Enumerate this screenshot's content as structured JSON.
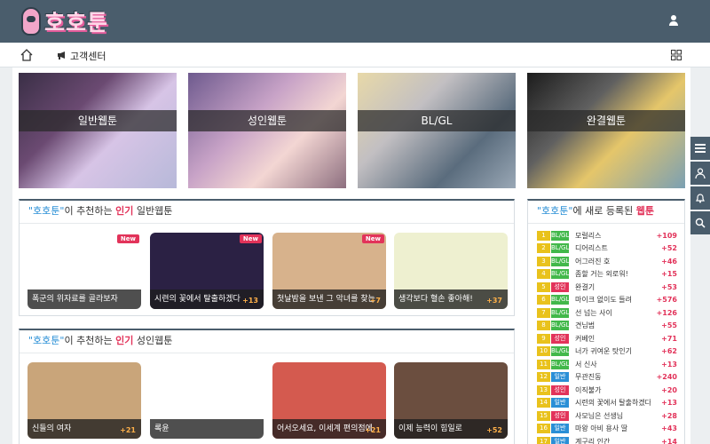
{
  "header": {
    "logo_text": "호호툰",
    "user_icon": "user-icon"
  },
  "subnav": {
    "home_icon": "home-icon",
    "cs_label": "고객센터",
    "cs_icon": "megaphone-icon",
    "grid_icon": "grid-icon"
  },
  "banners": [
    {
      "label": "일반웹툰"
    },
    {
      "label": "성인웹툰"
    },
    {
      "label": "BL/GL"
    },
    {
      "label": "완결웹툰"
    }
  ],
  "general_section": {
    "brand": "\"호호툰\"",
    "mid": "이 추천하는",
    "hot": "인기",
    "tail": "일반웹툰",
    "cards": [
      {
        "title": "폭군의 위자료를 골라보자",
        "count": "",
        "new": "New",
        "bg": "#ffffff"
      },
      {
        "title": "시련의 꽃에서 탈출하겠다",
        "count": "+13",
        "new": "New",
        "bg": "#2b2144"
      },
      {
        "title": "첫날밤을 보낸 그 악녀를 찾는",
        "count": "+7",
        "new": "New",
        "bg": "#d7b28c"
      },
      {
        "title": "생각보다 혈손 좋아해!",
        "count": "+37",
        "new": "",
        "bg": "#eef0d0"
      }
    ]
  },
  "adult_section": {
    "brand": "\"호호툰\"",
    "mid": "이 추천하는",
    "hot": "인기",
    "tail": "성인웹툰",
    "cards": [
      {
        "title": "신들의 여자",
        "count": "+21",
        "bg": "#c9a57a"
      },
      {
        "title": "록윤",
        "count": "",
        "bg": "#ffffff"
      },
      {
        "title": "어서오세요, 이세계 편의점에",
        "count": "+21",
        "bg": "#d45a4f"
      },
      {
        "title": "이제 능력이 힘일로",
        "count": "+52",
        "bg": "#6b4e3f"
      }
    ]
  },
  "ranking": {
    "brand": "\"호호툰\"",
    "mid": "에 새로 등록된",
    "hot": "웹툰",
    "items": [
      {
        "num": "1",
        "cat": "BL/GL",
        "title": "모럴리스",
        "delta": "+109"
      },
      {
        "num": "2",
        "cat": "BL/GL",
        "title": "디어리스트",
        "delta": "+52"
      },
      {
        "num": "3",
        "cat": "BL/GL",
        "title": "어그러진 호",
        "delta": "+46"
      },
      {
        "num": "4",
        "cat": "BL/GL",
        "title": "좀할 거는 외로워!",
        "delta": "+15"
      },
      {
        "num": "5",
        "cat": "성인",
        "title": "완결기",
        "delta": "+53"
      },
      {
        "num": "6",
        "cat": "BL/GL",
        "title": "마이크 없이도 들려",
        "delta": "+576"
      },
      {
        "num": "7",
        "cat": "BL/GL",
        "title": "선 넘는 사이",
        "delta": "+126"
      },
      {
        "num": "8",
        "cat": "BL/GL",
        "title": "견님범",
        "delta": "+55"
      },
      {
        "num": "9",
        "cat": "성인",
        "title": "커베인",
        "delta": "+71"
      },
      {
        "num": "10",
        "cat": "BL/GL",
        "title": "너가 귀여운 탓인기",
        "delta": "+62"
      },
      {
        "num": "11",
        "cat": "BL/GL",
        "title": "서 신사",
        "delta": "+13"
      },
      {
        "num": "12",
        "cat": "일반",
        "title": "무관진동",
        "delta": "+240"
      },
      {
        "num": "13",
        "cat": "성인",
        "title": "이직불가",
        "delta": "+20"
      },
      {
        "num": "14",
        "cat": "일반",
        "title": "시련의 꽃에서 탈출하겠다",
        "delta": "+13"
      },
      {
        "num": "15",
        "cat": "성인",
        "title": "사모님은 선생님",
        "delta": "+28"
      },
      {
        "num": "16",
        "cat": "일반",
        "title": "마왕 아비 용사 딸",
        "delta": "+43"
      },
      {
        "num": "17",
        "cat": "일반",
        "title": "계구리 인간",
        "delta": "+14"
      }
    ],
    "cat_colors": {
      "BL/GL": "#42b84a",
      "성인": "#e2335a",
      "일반": "#2a8fd6"
    }
  },
  "side_tools": [
    {
      "icon": "menu-icon"
    },
    {
      "icon": "user-icon"
    },
    {
      "icon": "bell-icon"
    },
    {
      "icon": "search-icon"
    }
  ]
}
